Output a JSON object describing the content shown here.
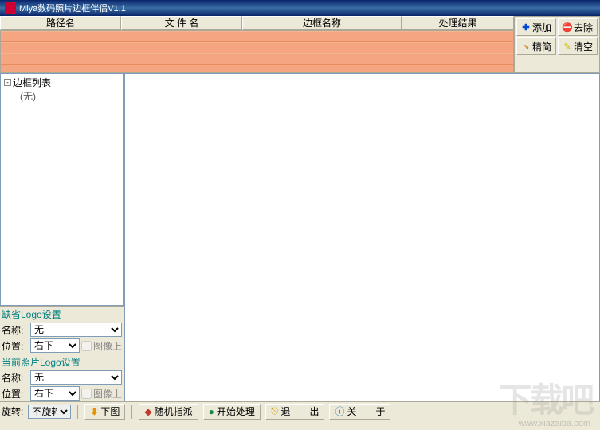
{
  "window": {
    "title": "Miya数码照片边框伴侣V1.1"
  },
  "table": {
    "headers": [
      "路径名",
      "文 件 名",
      "边框名称",
      "处理结果"
    ]
  },
  "buttons": {
    "add": "添加",
    "remove": "去除",
    "slim": "精简",
    "clear": "清空"
  },
  "tree": {
    "root": "边框列表",
    "empty": "(无)"
  },
  "logo_default": {
    "title": "缺省Logo设置",
    "name_label": "名称:",
    "name_value": "无",
    "pos_label": "位置:",
    "pos_value": "右下",
    "over_label": "图像上"
  },
  "logo_current": {
    "title": "当前照片Logo设置",
    "name_label": "名称:",
    "name_value": "无",
    "pos_label": "位置:",
    "pos_value": "右下",
    "over_label": "图像上"
  },
  "toolbar": {
    "rotate_label": "旋转:",
    "rotate_value": "不旋转",
    "next_img": "下图",
    "random": "随机指派",
    "process": "开始处理",
    "exit": "退　　出",
    "about": "关　　于"
  },
  "watermark": {
    "big": "下载吧",
    "url": "www.xiazaiba.com"
  }
}
